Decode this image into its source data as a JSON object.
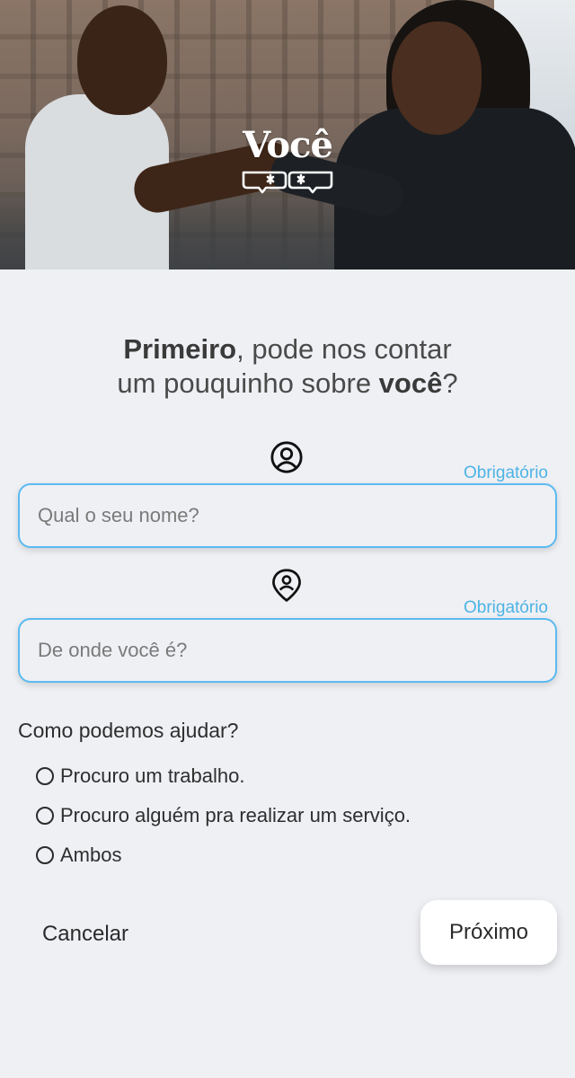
{
  "hero": {
    "logo_text": "Você",
    "logo_icon": "fist-bump-icon"
  },
  "headline": {
    "line1_bold": "Primeiro",
    "line1_rest": ", pode nos contar",
    "line2_start": "um pouquinho sobre ",
    "line2_bold": "você",
    "line2_end": "?"
  },
  "form": {
    "name": {
      "icon": "user-circle-icon",
      "required_label": "Obrigatório",
      "placeholder": "Qual o seu nome?",
      "value": ""
    },
    "location": {
      "icon": "location-pin-user-icon",
      "required_label": "Obrigatório",
      "placeholder": "De onde você é?",
      "value": ""
    },
    "help": {
      "question": "Como podemos ajudar?",
      "options": [
        "Procuro um trabalho.",
        "Procuro alguém pra realizar um serviço.",
        "Ambos"
      ]
    }
  },
  "actions": {
    "cancel_label": "Cancelar",
    "next_label": "Próximo"
  },
  "colors": {
    "background": "#eff0f4",
    "accent": "#5bbaf0",
    "required_text": "#4db3e6",
    "button_bg": "#ffffff"
  }
}
